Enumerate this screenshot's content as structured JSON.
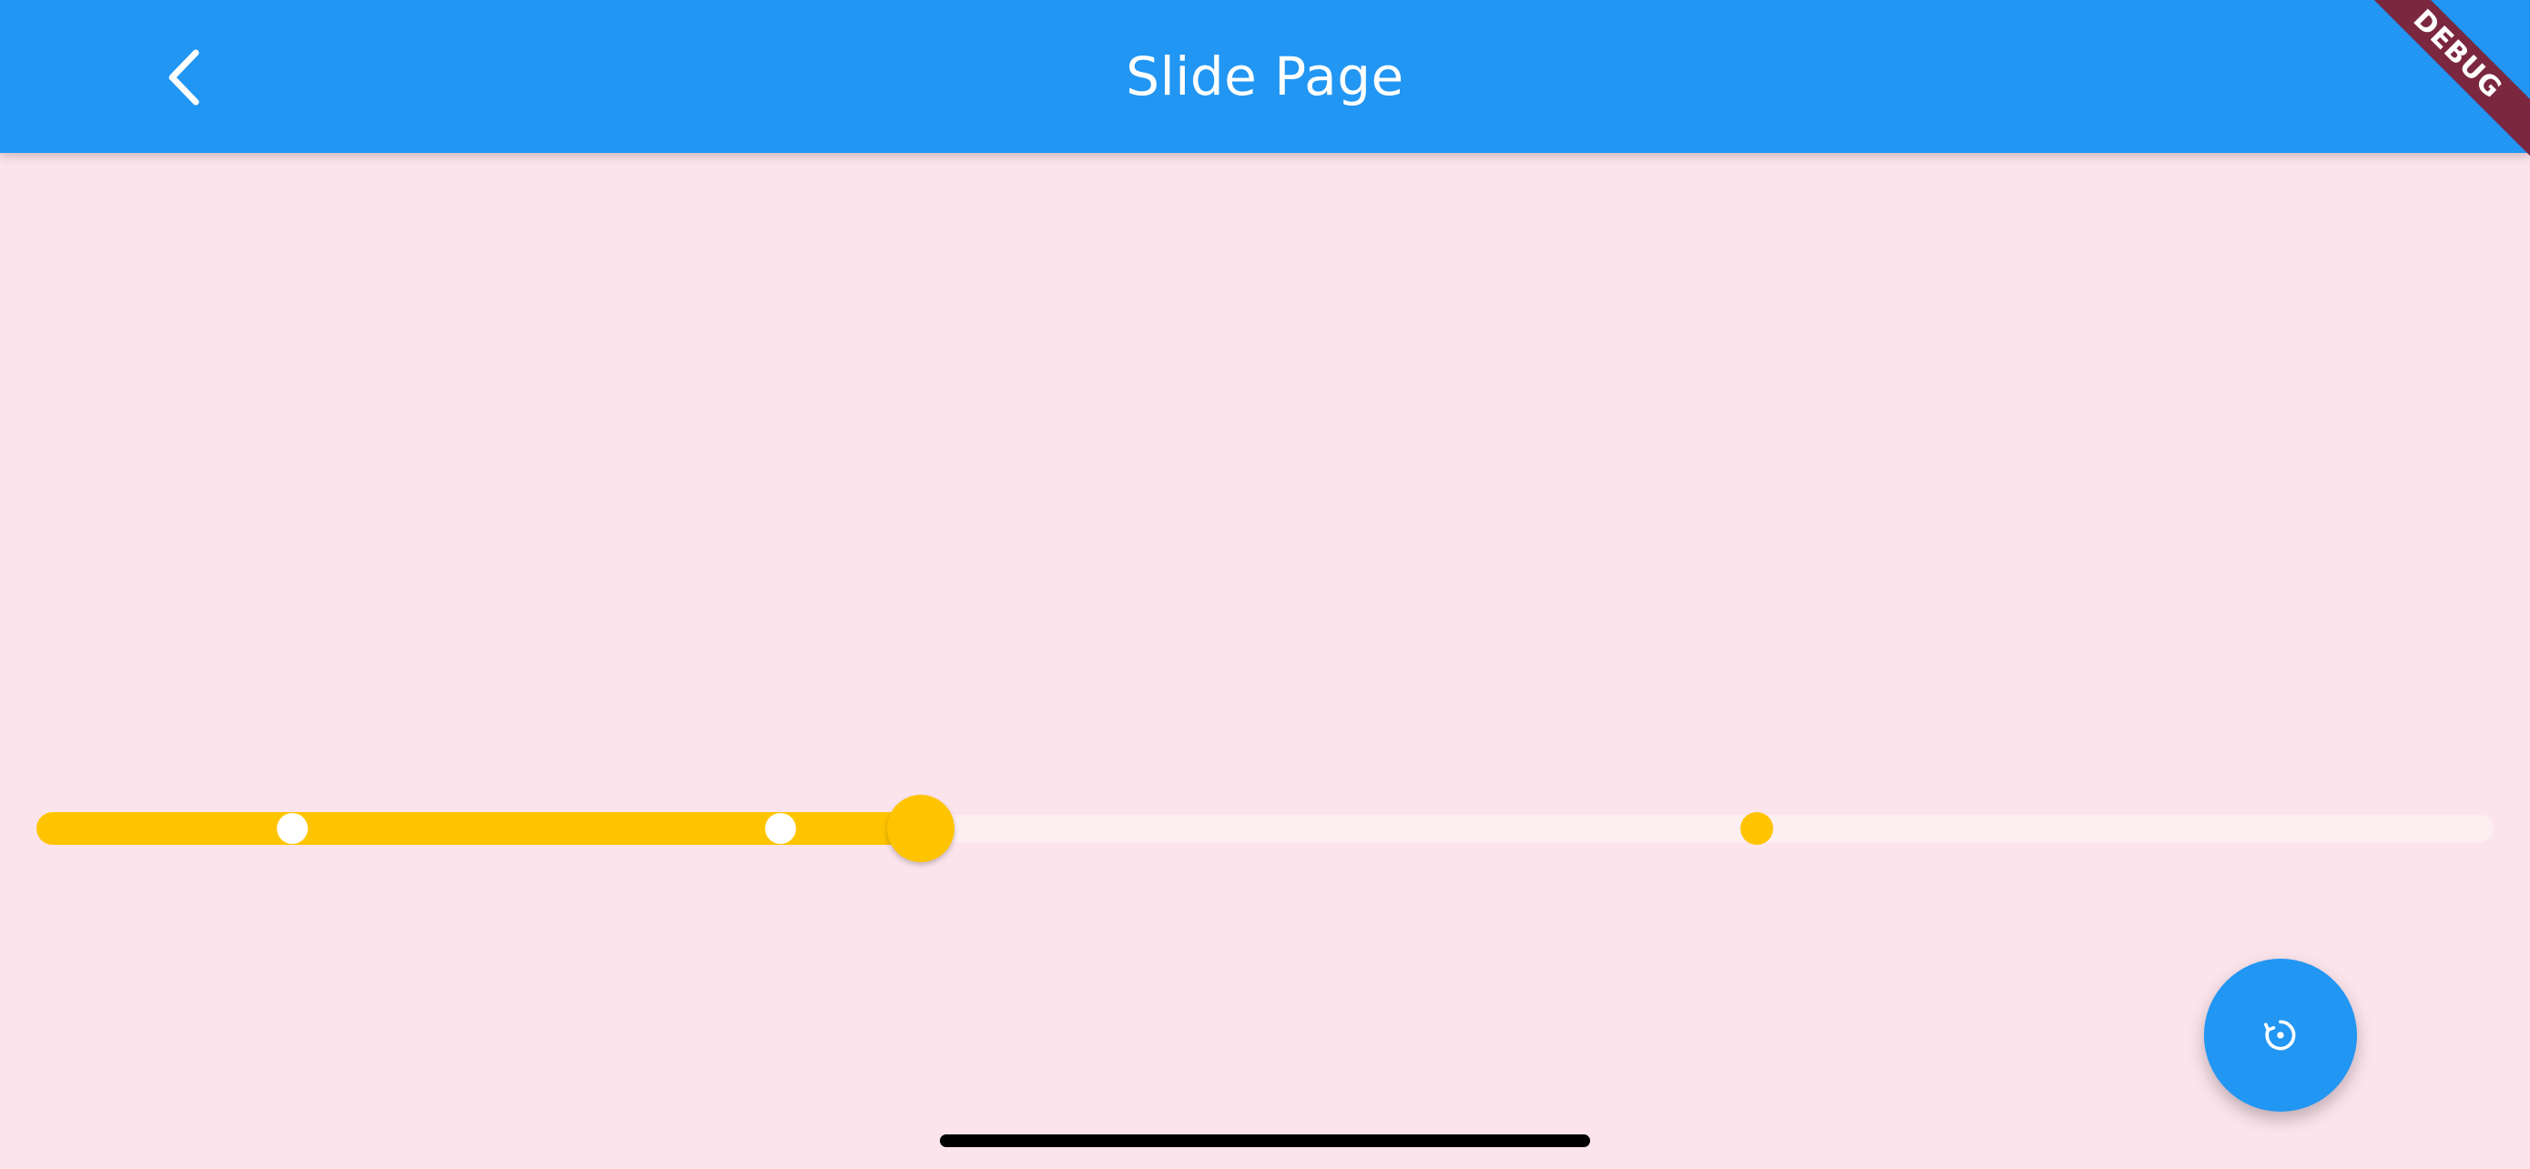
{
  "app_bar": {
    "title": "Slide Page",
    "back_icon": "chevron-left-icon",
    "background_color": "#2196f3",
    "debug_banner": "DEBUG",
    "debug_banner_color": "#7b2740"
  },
  "slider": {
    "min": 0,
    "max": 5,
    "divisions": 5,
    "value": 1.8,
    "value_fraction": 0.36,
    "tick_fractions": [
      0.104,
      0.303,
      0.7
    ],
    "active_color": "#ffc400",
    "inactive_color": "#fdeef2"
  },
  "fab": {
    "icon": "restore-icon",
    "color": "#2196f3"
  },
  "page": {
    "background_color": "#fce4ec"
  }
}
